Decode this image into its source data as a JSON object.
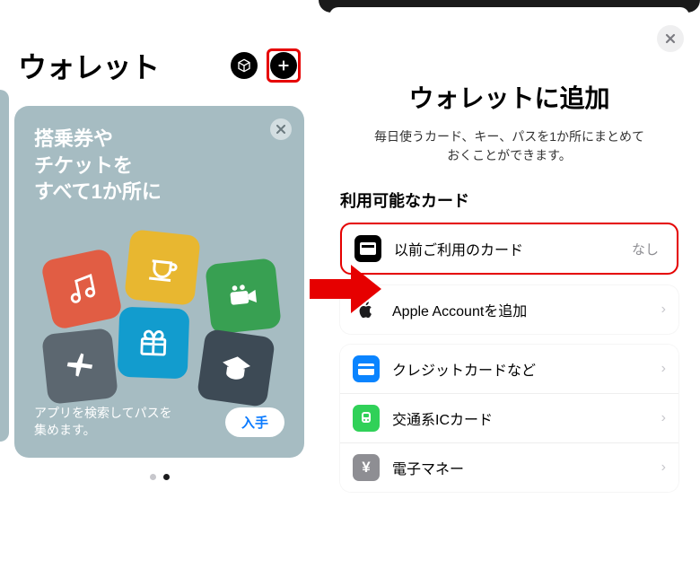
{
  "left": {
    "title": "ウォレット",
    "promo": {
      "line1": "搭乗券や",
      "line2": "チケットを",
      "line3": "すべて1か所に",
      "caption1": "アプリを検索してパスを",
      "caption2": "集めます。",
      "button": "入手"
    }
  },
  "right": {
    "title": "ウォレットに追加",
    "sub1": "毎日使うカード、キー、パスを1か所にまとめて",
    "sub2": "おくことができます。",
    "section": "利用可能なカード",
    "rows": {
      "previous": {
        "label": "以前ご利用のカード",
        "meta": "なし"
      },
      "apple": {
        "label": "Apple Accountを追加"
      },
      "credit": {
        "label": "クレジットカードなど"
      },
      "transit": {
        "label": "交通系ICカード"
      },
      "emoney": {
        "label": "電子マネー"
      }
    }
  }
}
